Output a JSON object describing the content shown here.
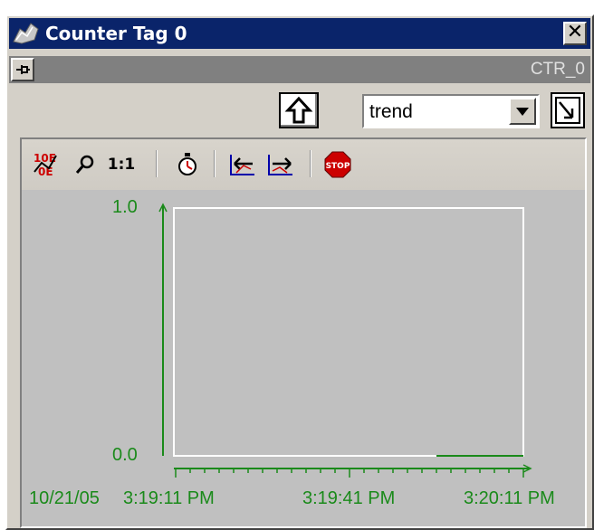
{
  "window": {
    "title": "Counter Tag 0",
    "close_glyph": "✕",
    "tag_name": "CTR_0"
  },
  "view": {
    "selected": "trend"
  },
  "toolbar": {
    "buttons": [
      {
        "name": "scale-toggle-icon"
      },
      {
        "name": "zoom-icon"
      },
      {
        "name": "actual-size-icon",
        "label": "1:1"
      },
      {
        "name": "timer-icon"
      },
      {
        "name": "scroll-back-icon"
      },
      {
        "name": "scroll-forward-icon"
      },
      {
        "name": "stop-icon"
      }
    ]
  },
  "colors": {
    "accent": "#1a8a1a",
    "titlebar": "#0a246a",
    "stop": "#cc0000"
  },
  "chart_data": {
    "type": "line",
    "ylim": [
      0.0,
      1.0
    ],
    "y_ticks": [
      "1.0",
      "0.0"
    ],
    "x_date": "10/21/05",
    "x_ticks": [
      "3:19:11 PM",
      "3:19:41 PM",
      "3:20:11 PM"
    ],
    "series": [
      {
        "x": [
          "3:19:56 PM",
          "3:20:11 PM"
        ],
        "y": [
          0.0,
          0.0
        ]
      }
    ],
    "grid": false
  }
}
